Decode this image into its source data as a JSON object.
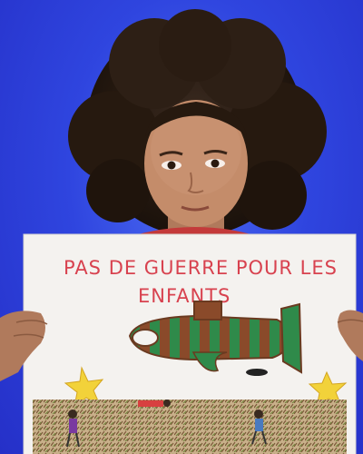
{
  "image": {
    "type": "photograph",
    "subject": "child holding hand-drawn protest sign",
    "background_color": "#2f45df"
  },
  "sign": {
    "line1": "PAS DE GUERRE POUR LES",
    "line2": "ENFANTS",
    "text_color": "#d8424f"
  }
}
